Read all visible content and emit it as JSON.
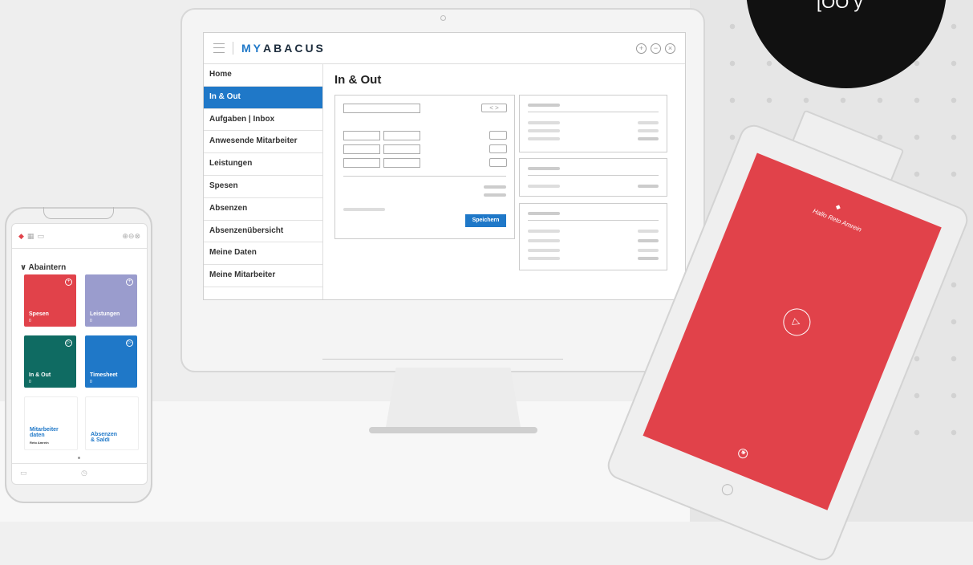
{
  "brand": {
    "logo_prefix": "MY",
    "logo_rest": "ABACUS",
    "accent": "#1f78c8"
  },
  "corner_text": "[OO y",
  "desktop": {
    "topbar_icons": [
      "+",
      "−",
      "×"
    ],
    "sidebar": {
      "items": [
        {
          "label": "Home",
          "active": false
        },
        {
          "label": "In & Out",
          "active": true
        },
        {
          "label": "Aufgaben | Inbox",
          "active": false
        },
        {
          "label": "Anwesende Mitarbeiter",
          "active": false
        },
        {
          "label": "Leistungen",
          "active": false
        },
        {
          "label": "Spesen",
          "active": false
        },
        {
          "label": "Absenzen",
          "active": false
        },
        {
          "label": "Absenzenübersicht",
          "active": false
        },
        {
          "label": "Meine Daten",
          "active": false
        },
        {
          "label": "Meine Mitarbeiter",
          "active": false
        }
      ]
    },
    "main": {
      "title": "In & Out",
      "save_label": "Speichern",
      "nav_prev": "<",
      "nav_next": ">"
    }
  },
  "phone": {
    "section": "Abaintern",
    "tiles": [
      {
        "label": "Spesen",
        "count": "0",
        "color": "#e1424a",
        "icon": "+"
      },
      {
        "label": "Leistungen",
        "count": "0",
        "color": "#9a9ccd",
        "icon": "+"
      },
      {
        "label": "In & Out",
        "count": "0",
        "color": "#0f6b62",
        "icon": "▷"
      },
      {
        "label": "Timesheet",
        "count": "0",
        "color": "#1f78c8",
        "icon": "▷"
      },
      {
        "label": "Mitarbeiter daten",
        "sub": "Reto Amrein",
        "color": "#ffffff"
      },
      {
        "label": "Absenzen & Saldi",
        "color": "#ffffff"
      }
    ]
  },
  "tablet": {
    "greeting": "Hallo Reto Amrein",
    "screen_color": "#e1424a"
  }
}
